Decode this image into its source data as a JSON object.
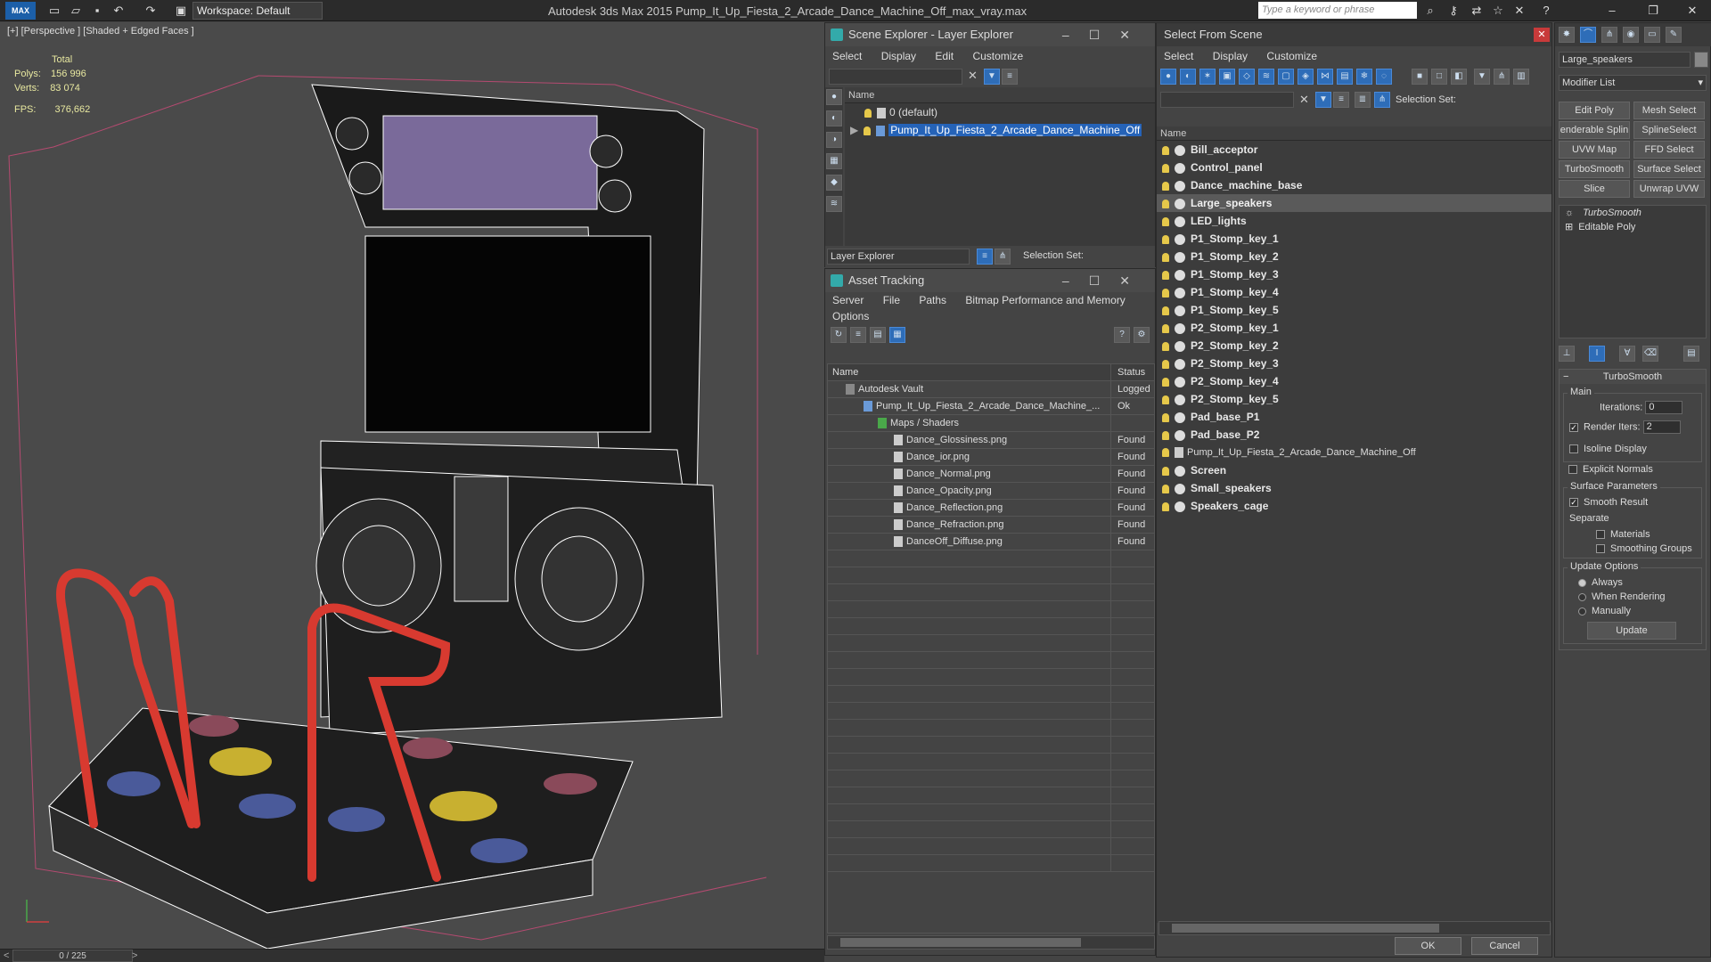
{
  "titlebar": {
    "logo": "MAX",
    "workspace": "Workspace: Default",
    "app_title": "Autodesk 3ds Max  2015      Pump_It_Up_Fiesta_2_Arcade_Dance_Machine_Off_max_vray.max",
    "search_placeholder": "Type a keyword or phrase"
  },
  "viewport": {
    "label": "[+] [Perspective ] [Shaded + Edged Faces ]",
    "stats_total": "Total",
    "polys_label": "Polys:",
    "polys_value": "156 996",
    "verts_label": "Verts:",
    "verts_value": "83 074",
    "fps_label": "FPS:",
    "fps_value": "376,662"
  },
  "timeline": {
    "frame": "0 / 225"
  },
  "scene_explorer": {
    "title": "Scene Explorer - Layer Explorer",
    "menu": [
      "Select",
      "Display",
      "Edit",
      "Customize"
    ],
    "col_name": "Name",
    "rows": [
      "0 (default)",
      "Pump_It_Up_Fiesta_2_Arcade_Dance_Machine_Off"
    ],
    "footer_explorer": "Layer Explorer",
    "footer_selset": "Selection Set:"
  },
  "asset_tracking": {
    "title": "Asset Tracking",
    "menu": [
      "Server",
      "File",
      "Paths",
      "Bitmap Performance and Memory"
    ],
    "menu2": "Options",
    "col_name": "Name",
    "col_status": "Status",
    "rows": [
      {
        "name": "Autodesk Vault",
        "status": "Logged"
      },
      {
        "name": "Pump_It_Up_Fiesta_2_Arcade_Dance_Machine_...",
        "status": "Ok"
      },
      {
        "name": "Maps / Shaders",
        "status": ""
      },
      {
        "name": "Dance_Glossiness.png",
        "status": "Found"
      },
      {
        "name": "Dance_ior.png",
        "status": "Found"
      },
      {
        "name": "Dance_Normal.png",
        "status": "Found"
      },
      {
        "name": "Dance_Opacity.png",
        "status": "Found"
      },
      {
        "name": "Dance_Reflection.png",
        "status": "Found"
      },
      {
        "name": "Dance_Refraction.png",
        "status": "Found"
      },
      {
        "name": "DanceOff_Diffuse.png",
        "status": "Found"
      }
    ]
  },
  "select_from_scene": {
    "title": "Select From Scene",
    "menu": [
      "Select",
      "Display",
      "Customize"
    ],
    "selset": "Selection Set:",
    "col_name": "Name",
    "items": [
      "Bill_acceptor",
      "Control_panel",
      "Dance_machine_base",
      "Large_speakers",
      "LED_lights",
      "P1_Stomp_key_1",
      "P1_Stomp_key_2",
      "P1_Stomp_key_3",
      "P1_Stomp_key_4",
      "P1_Stomp_key_5",
      "P2_Stomp_key_1",
      "P2_Stomp_key_2",
      "P2_Stomp_key_3",
      "P2_Stomp_key_4",
      "P2_Stomp_key_5",
      "Pad_base_P1",
      "Pad_base_P2",
      "Pump_It_Up_Fiesta_2_Arcade_Dance_Machine_Off",
      "Screen",
      "Small_speakers",
      "Speakers_cage"
    ],
    "ok": "OK",
    "cancel": "Cancel"
  },
  "modify_panel": {
    "object_name": "Large_speakers",
    "modifier_list": "Modifier List",
    "buttons": [
      "Edit Poly",
      "Mesh Select",
      "enderable Splin",
      "SplineSelect",
      "UVW Map",
      "FFD Select",
      "TurboSmooth",
      "Surface Select",
      "Slice",
      "Unwrap UVW"
    ],
    "stack": [
      "TurboSmooth",
      "Editable Poly"
    ],
    "rollout_title": "TurboSmooth",
    "main_label": "Main",
    "iterations_label": "Iterations:",
    "iterations_value": "0",
    "render_iters_label": "Render Iters:",
    "render_iters_value": "2",
    "isoline": "Isoline Display",
    "explicit_normals": "Explicit Normals",
    "surface_params": "Surface Parameters",
    "smooth_result": "Smooth Result",
    "separate": "Separate",
    "materials": "Materials",
    "smoothing_groups": "Smoothing Groups",
    "update_options": "Update Options",
    "always": "Always",
    "when_rendering": "When Rendering",
    "manually": "Manually",
    "update": "Update"
  }
}
